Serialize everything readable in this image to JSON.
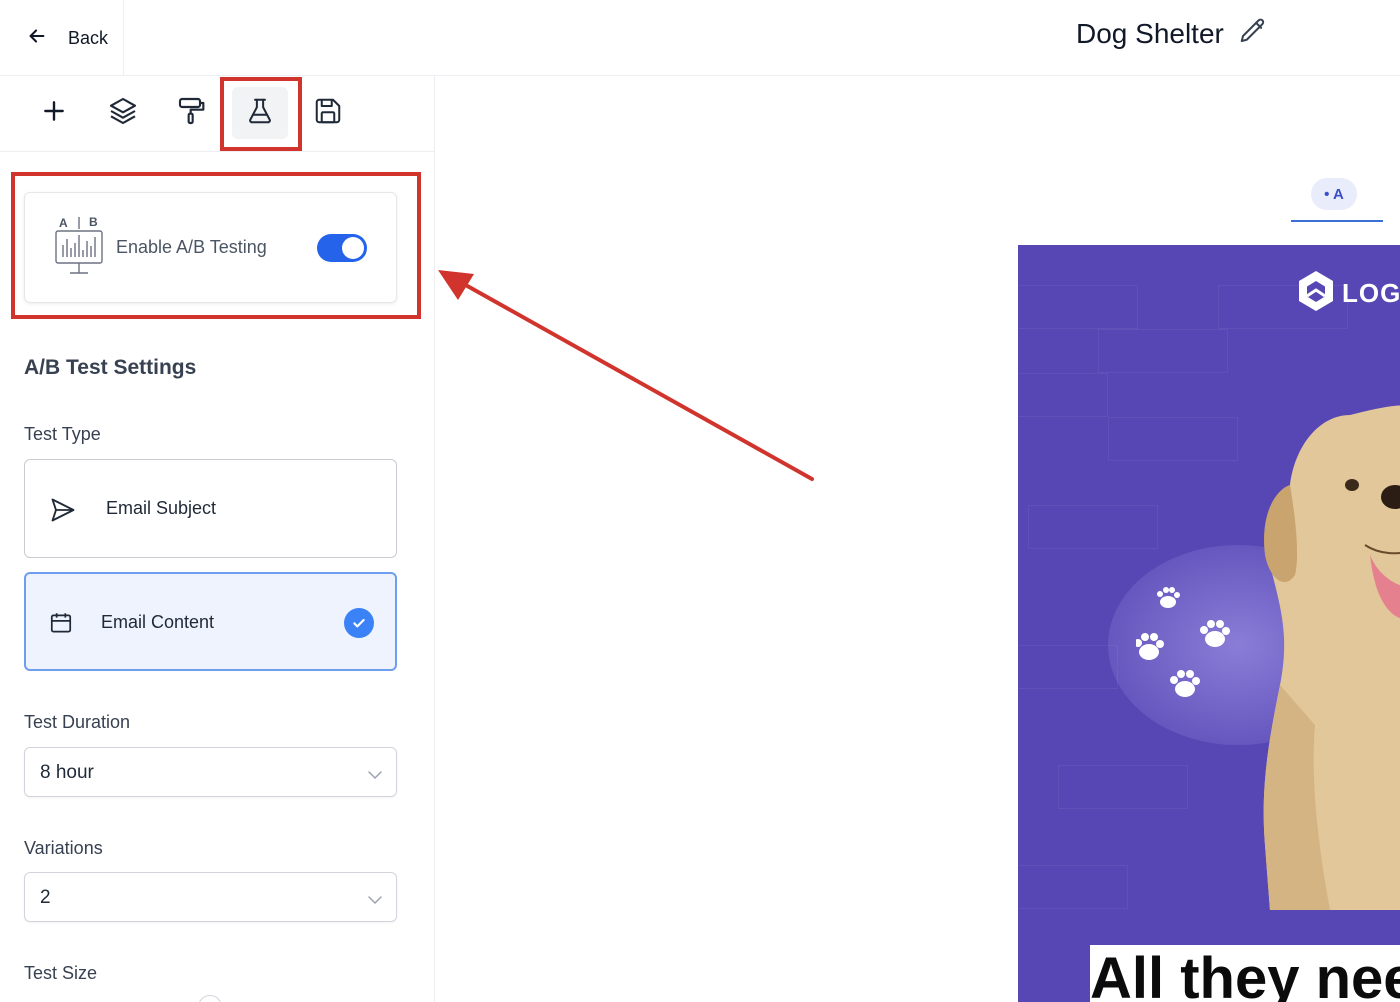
{
  "header": {
    "back_label": "Back",
    "document_title": "Dog Shelter"
  },
  "toolbar": {
    "tools": [
      {
        "name": "add",
        "icon": "plus-icon"
      },
      {
        "name": "layers",
        "icon": "layers-icon"
      },
      {
        "name": "style",
        "icon": "paint-roller-icon"
      },
      {
        "name": "ab-testing",
        "icon": "flask-icon",
        "active": true
      },
      {
        "name": "save",
        "icon": "save-icon"
      }
    ]
  },
  "ab_panel": {
    "graphic_label_a": "A",
    "graphic_label_b": "B",
    "enable_label": "Enable A/B Testing",
    "enabled": true,
    "settings_title": "A/B Test Settings",
    "test_type_label": "Test Type",
    "test_types": [
      {
        "label": "Email Subject",
        "icon": "send-icon",
        "selected": false
      },
      {
        "label": "Email Content",
        "icon": "calendar-icon",
        "selected": true
      }
    ],
    "duration_label": "Test Duration",
    "duration_value": "8 hour",
    "variations_label": "Variations",
    "variations_value": "2",
    "test_size_label": "Test Size"
  },
  "canvas": {
    "variant_tab": "• A",
    "logo_text": "LOGO",
    "headline": "All they need"
  },
  "colors": {
    "accent": "#2563eb",
    "annotation": "#d0342c",
    "email_bg": "#5747b5"
  }
}
